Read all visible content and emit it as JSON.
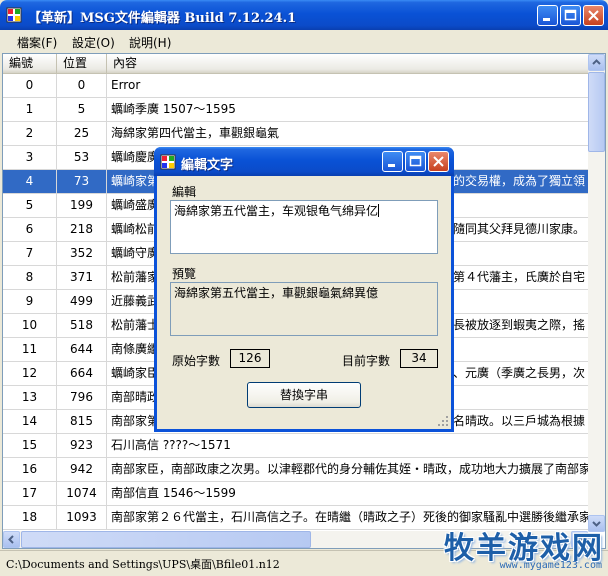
{
  "window": {
    "title": "【革新】MSG文件編輯器 Build 7.12.24.1"
  },
  "menu": [
    {
      "label": "檔案(F)"
    },
    {
      "label": "設定(O)"
    },
    {
      "label": "說明(H)"
    }
  ],
  "table": {
    "headers": [
      "編號",
      "位置",
      "內容"
    ],
    "rows": [
      {
        "id": "0",
        "pos": "0",
        "text": "Error"
      },
      {
        "id": "1",
        "pos": "5",
        "text": "蠣崎季廣 1507～1595"
      },
      {
        "id": "2",
        "pos": "25",
        "text": "海綿家第四代當主，車觀銀龜氣"
      },
      {
        "id": "3",
        "pos": "53",
        "text": "蠣崎慶廣"
      },
      {
        "id": "4",
        "pos": "73",
        "text": "蠣崎家第",
        "text_tail": "的交易權，成為了獨立領"
      },
      {
        "id": "5",
        "pos": "199",
        "text": "蠣崎盛廣"
      },
      {
        "id": "6",
        "pos": "218",
        "text": "蠣崎松前",
        "text_tail": "隨同其父拜見德川家康。"
      },
      {
        "id": "7",
        "pos": "352",
        "text": "蠣崎守廣"
      },
      {
        "id": "8",
        "pos": "371",
        "text": "松前藩家",
        "text_tail": "第４代藩主，氏廣於自宅"
      },
      {
        "id": "9",
        "pos": "499",
        "text": "近藤義武"
      },
      {
        "id": "10",
        "pos": "518",
        "text": "松前藩士",
        "text_tail": "長被放逐到蝦夷之際，搖"
      },
      {
        "id": "11",
        "pos": "644",
        "text": "南條廣繼"
      },
      {
        "id": "12",
        "pos": "664",
        "text": "蠣崎家臣",
        "text_tail": "、元廣（季廣之長男，次"
      },
      {
        "id": "13",
        "pos": "796",
        "text": "南部晴政"
      },
      {
        "id": "14",
        "pos": "815",
        "text": "南部家第",
        "text_tail": "名晴政。以三戶城為根據"
      },
      {
        "id": "15",
        "pos": "923",
        "text": "石川高信 ????～1571"
      },
      {
        "id": "16",
        "pos": "942",
        "text": "南部家臣，南部政康之次男。以津輕郡代的身分輔佐其姪・晴政，成功地大力擴展了南部家"
      },
      {
        "id": "17",
        "pos": "1074",
        "text": "南部信直 1546～1599"
      },
      {
        "id": "18",
        "pos": "1093",
        "text": "南部家第２６代當主，石川高信之子。在晴繼（晴政之子）死後的御家騷亂中選勝後繼承家"
      }
    ],
    "selected_row": 4
  },
  "status": {
    "path": "C:\\Documents and Settings\\UPS\\桌面\\Bfile01.n12"
  },
  "watermark": {
    "big": "牧羊游戏网",
    "small": "www.mygame123.com"
  },
  "dialog": {
    "title": "編輯文字",
    "edit_label": "編輯",
    "edit_value": "海綿家第五代當主，车观银龟气绵异亿",
    "preview_label": "預覽",
    "preview_value": "海綿家第五代當主，車觀銀龜氣綿異億",
    "original_count_label": "原始字數",
    "original_count": "126",
    "current_count_label": "目前字數",
    "current_count": "34",
    "replace_button": "替換字串"
  }
}
